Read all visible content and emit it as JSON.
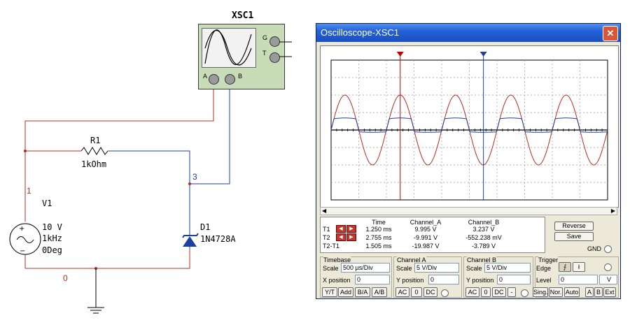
{
  "schematic": {
    "xsc1_label": "XSC1",
    "terminal_g": "G",
    "terminal_t": "T",
    "terminal_a": "A",
    "terminal_b": "B",
    "r1_name": "R1",
    "r1_value": "1kOhm",
    "v1_name": "V1",
    "v1_amp": "10 V",
    "v1_freq": "1kHz",
    "v1_phase": "0Deg",
    "d1_name": "D1",
    "d1_part": "1N4728A",
    "node_1": "1",
    "node_3": "3",
    "node_0": "0",
    "colors": {
      "wire_red": "#b03020",
      "wire_blue": "#1e3fa0",
      "diode": "#1e3fa0"
    }
  },
  "oscilloscope": {
    "title": "Oscilloscope-XSC1",
    "close_glyph": "✕",
    "colors": {
      "channel_a": "#b03020",
      "channel_b": "#1e3fa0",
      "cursor_t1": "#c00000",
      "cursor_t2": "#1e3fa0"
    },
    "measurements": {
      "headers": [
        "Time",
        "Channel_A",
        "Channel_B"
      ],
      "rows": [
        {
          "label": "T1",
          "time": "1.250 ms",
          "a": "9.995 V",
          "b": "3.237 V"
        },
        {
          "label": "T2",
          "time": "2.755 ms",
          "a": "-9.991 V",
          "b": "-552.238 mV"
        },
        {
          "label": "T2-T1",
          "time": "1.505 ms",
          "a": "-19.987 V",
          "b": "-3.789 V"
        }
      ]
    },
    "buttons": {
      "reverse": "Reverse",
      "save": "Save",
      "gnd": "GND"
    },
    "timebase": {
      "title": "Timebase",
      "scale_label": "Scale",
      "scale": "500 µs/Div",
      "xpos_label": "X position",
      "xpos": "0",
      "modes": [
        "Y/T",
        "Add",
        "B/A",
        "A/B"
      ]
    },
    "channel_a": {
      "title": "Channel A",
      "scale_label": "Scale",
      "scale": "5  V/Div",
      "ypos_label": "Y position",
      "ypos": "0",
      "coupling": [
        "AC",
        "0",
        "DC"
      ]
    },
    "channel_b": {
      "title": "Channel B",
      "scale_label": "Scale",
      "scale": "5  V/Div",
      "ypos_label": "Y position",
      "ypos": "0",
      "coupling": [
        "AC",
        "0",
        "DC",
        "-"
      ]
    },
    "trigger": {
      "title": "Trigger",
      "edge_label": "Edge",
      "level_label": "Level",
      "level": "0",
      "level_unit": "V",
      "modes": [
        "Sing.",
        "Nor.",
        "Auto"
      ],
      "sources": [
        "A",
        "B",
        "Ext"
      ]
    }
  }
}
